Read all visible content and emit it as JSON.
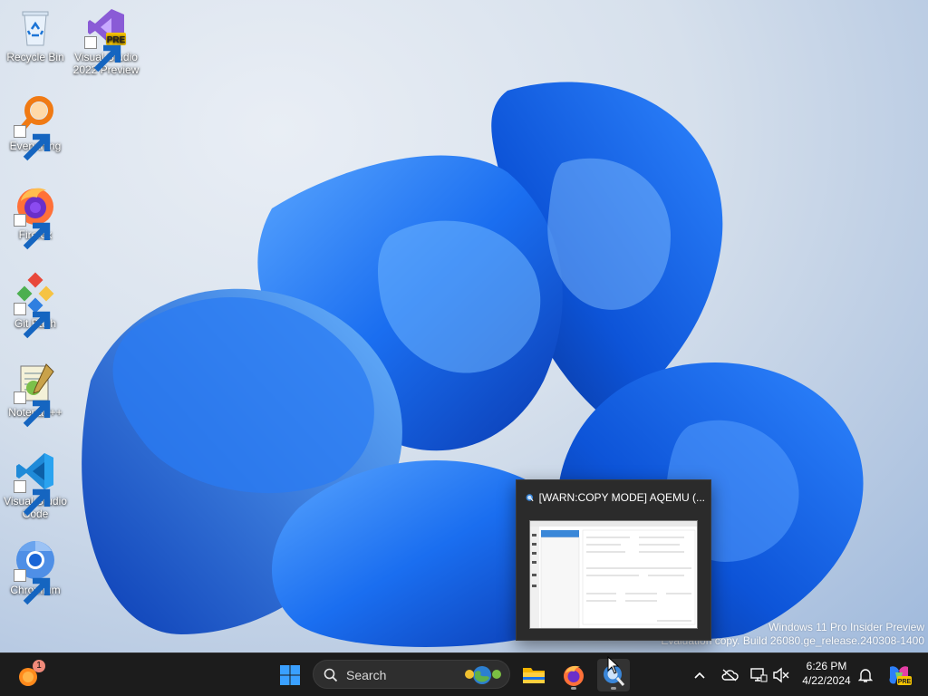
{
  "desktop": {
    "icons": [
      {
        "label": "Recycle Bin",
        "icon": "recycle-bin-icon"
      },
      {
        "label": "Visual Studio 2022 Preview",
        "icon": "visual-studio-preview-icon",
        "badge": "PRE"
      },
      {
        "label": "Everything",
        "icon": "everything-search-icon"
      },
      {
        "label": "Firefox",
        "icon": "firefox-icon"
      },
      {
        "label": "Git Bash",
        "icon": "git-bash-icon"
      },
      {
        "label": "Notepad++",
        "icon": "notepadpp-icon"
      },
      {
        "label": "Visual Studio Code",
        "icon": "vscode-icon"
      },
      {
        "label": "Chromium",
        "icon": "chromium-icon"
      }
    ],
    "watermark": {
      "line1": "Windows 11 Pro Insider Preview",
      "line2": "Evaluation copy. Build 26080.ge_release.240308-1400"
    }
  },
  "preview": {
    "title": "[WARN:COPY MODE] AQEMU (..."
  },
  "taskbar": {
    "notification_badge": "1",
    "search_label": "Search",
    "copilot_badge": "PRE",
    "time": "6:26 PM",
    "date": "4/22/2024"
  },
  "colors": {
    "taskbar": "#1c1c1c",
    "accent": "#0a63e0",
    "bloom_dark": "#0b3fb8",
    "bloom_light": "#3d8cf5"
  }
}
